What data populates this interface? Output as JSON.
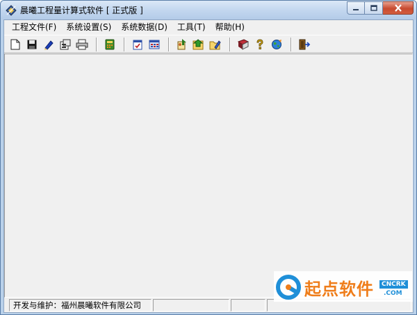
{
  "window": {
    "title": "晨曦工程量计算式软件 [ 正式版 ]"
  },
  "menu": {
    "items": [
      "工程文件(F)",
      "系统设置(S)",
      "系统数据(D)",
      "工具(T)",
      "帮助(H)"
    ]
  },
  "toolbar": {
    "icons": [
      "new-file-icon",
      "save-icon",
      "edit-icon",
      "properties-icon",
      "print-icon",
      "calculator-icon",
      "checklist-icon",
      "table-grid-icon",
      "export-icon",
      "import-icon",
      "edit-folder-icon",
      "book-icon",
      "help-icon",
      "world-icon",
      "exit-icon"
    ]
  },
  "status": {
    "developer": "开发与维护：福州晨曦软件有限公司"
  },
  "watermark": {
    "brand": "起点软件",
    "tag": "CNCRK",
    "domain": ".COM"
  },
  "colors": {
    "titlebar": "#c3d7ef",
    "close_button": "#c74a30",
    "client_bg": "#f0f0f0",
    "watermark_orange": "#ef7d1a",
    "watermark_blue": "#1f8fd8"
  }
}
